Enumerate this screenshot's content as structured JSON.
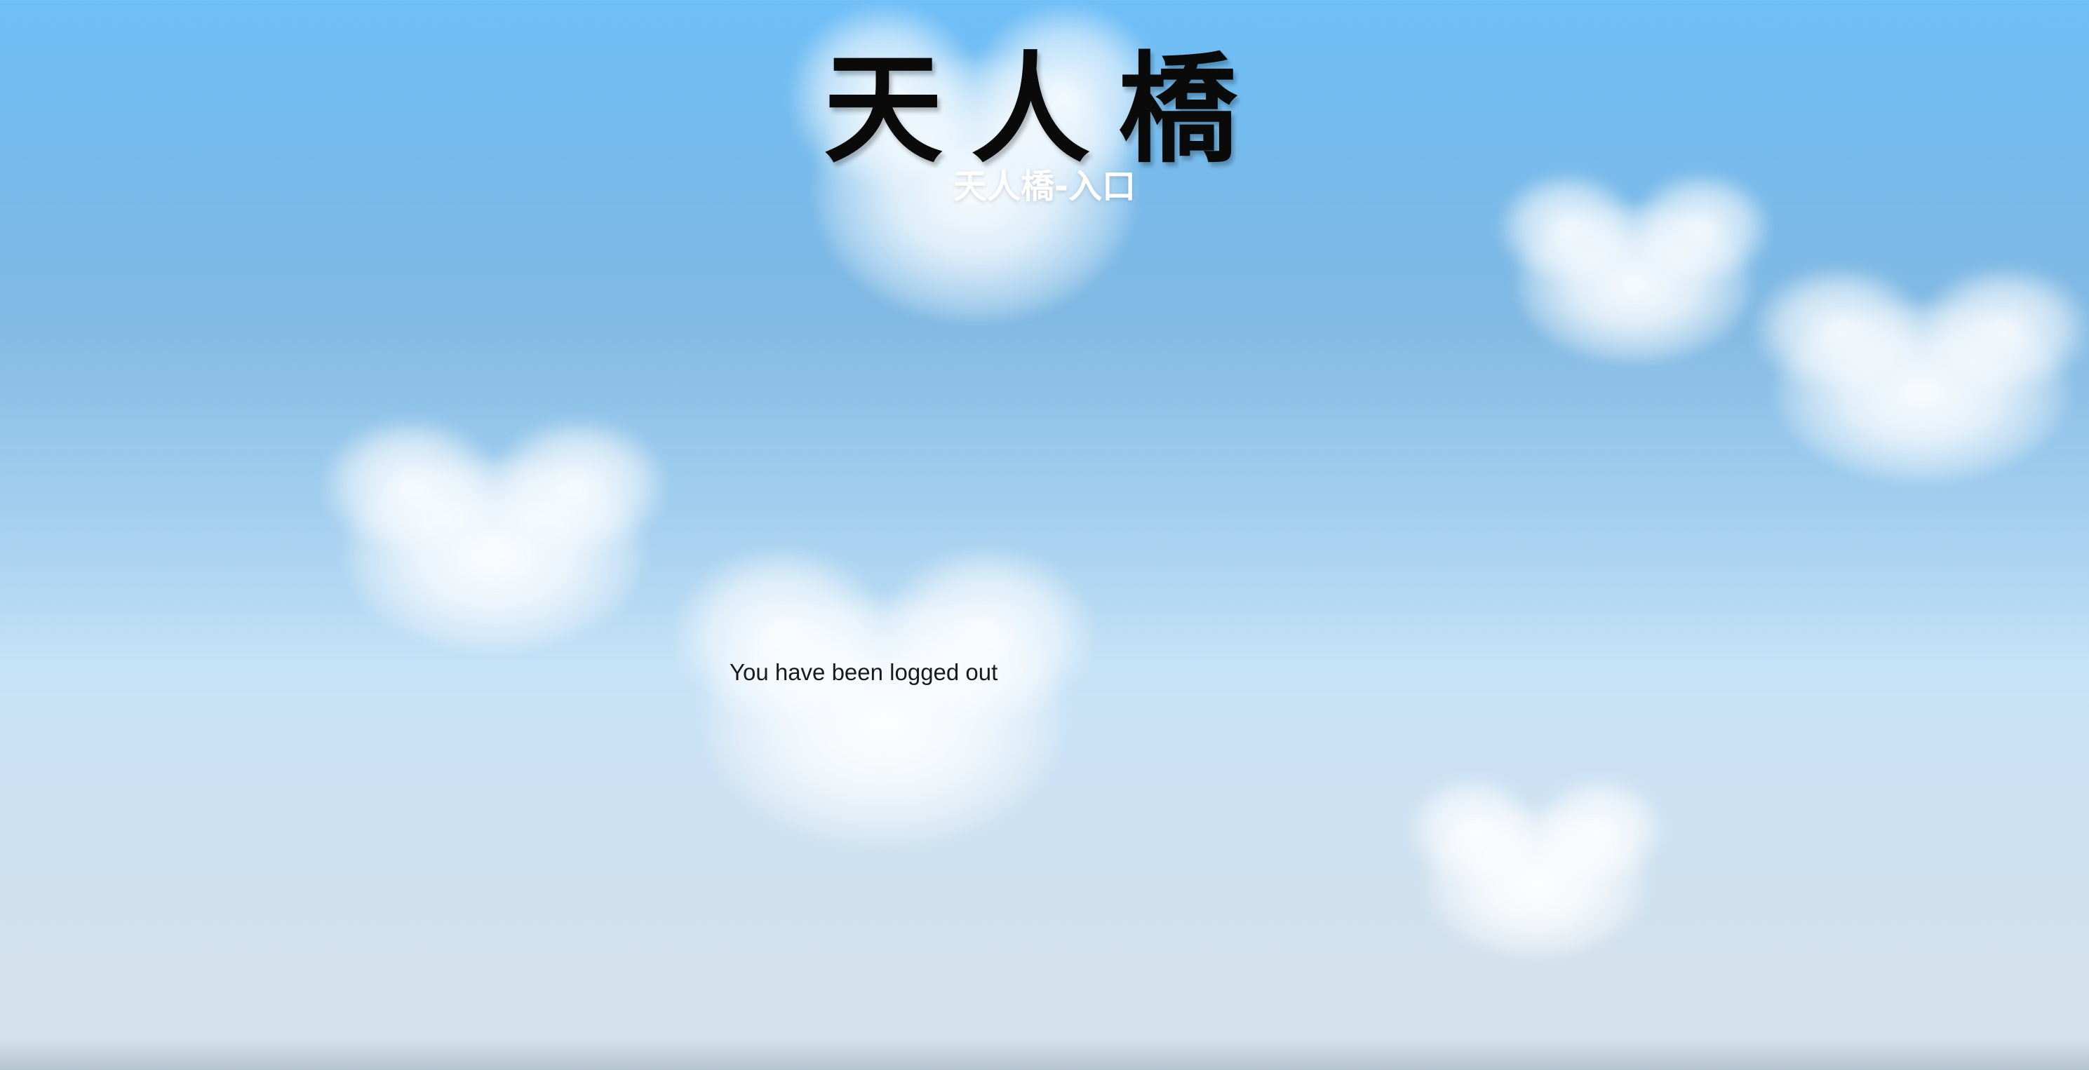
{
  "header": {
    "title": "天人橋",
    "subtitle": "天人橋-入口"
  },
  "main": {
    "message": "You have been logged out"
  },
  "colors": {
    "sky_top": "#6ebef8",
    "sky_bottom": "#d5e1ea",
    "title_color": "#0a0a0a",
    "subtitle_color": "#ffffff"
  }
}
